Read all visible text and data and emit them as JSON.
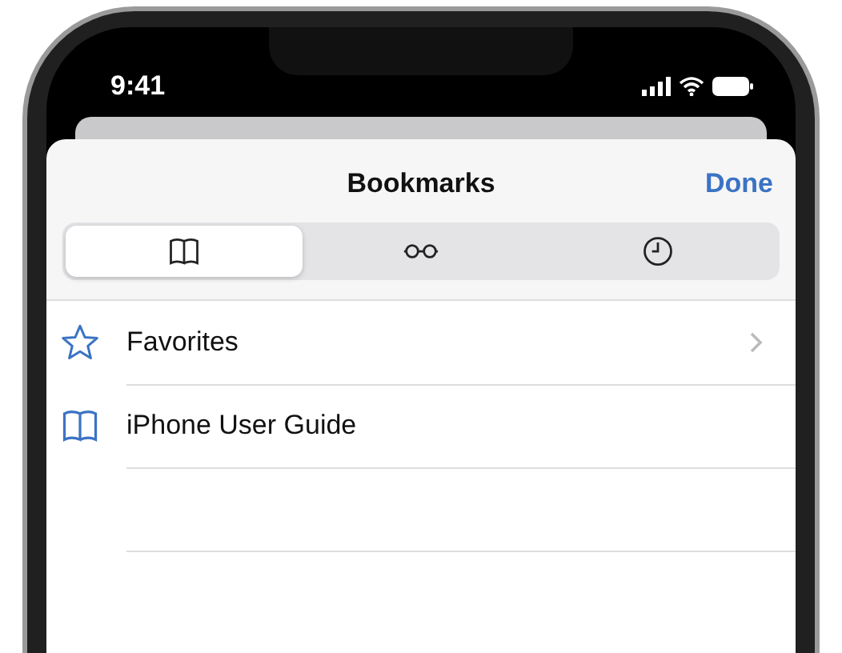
{
  "status_bar": {
    "time": "9:41"
  },
  "sheet": {
    "title": "Bookmarks",
    "done": "Done"
  },
  "tabs": [
    {
      "kind": "book",
      "selected": true
    },
    {
      "kind": "glasses",
      "selected": false
    },
    {
      "kind": "clock",
      "selected": false
    }
  ],
  "items": [
    {
      "kind": "star",
      "label": "Favorites",
      "disclosure": true
    },
    {
      "kind": "book",
      "label": "iPhone User Guide",
      "disclosure": false
    }
  ]
}
